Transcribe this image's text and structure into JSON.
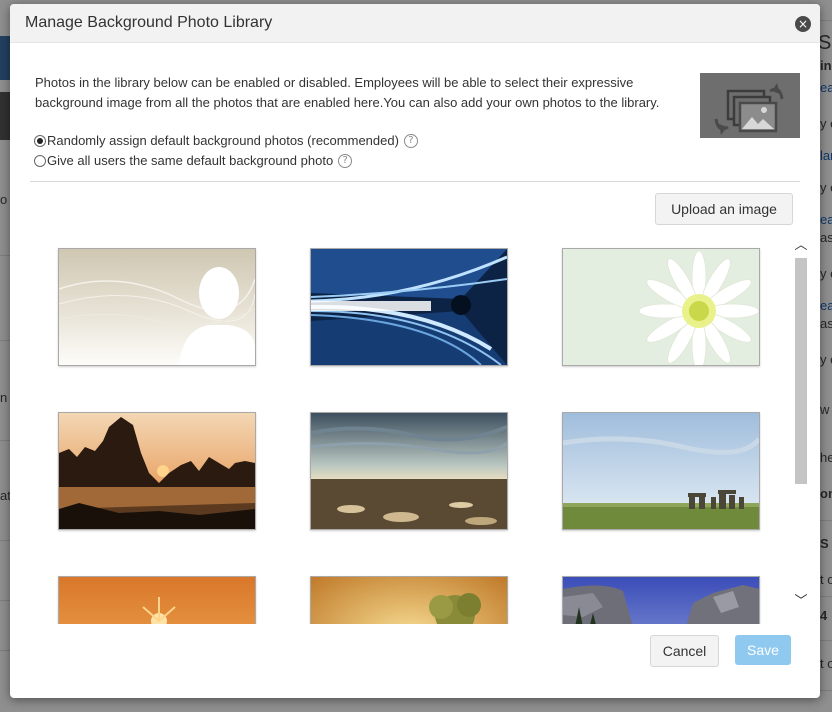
{
  "dialog": {
    "title": "Manage Background Photo Library",
    "close_glyph": "×",
    "description": "Photos in the library below can be enabled or disabled. Employees will be able to select their expressive background image from all the photos that are enabled here.You can also add your own photos to the library.",
    "hero_icon": "photo-library-sync-icon",
    "options": [
      {
        "label": "Randomly assign default background photos (recommended)",
        "selected": true
      },
      {
        "label": "Give all users the same default background photo",
        "selected": false
      }
    ],
    "help_glyph": "?",
    "upload_label": "Upload an image",
    "photos": [
      {
        "icon": "silhouette-photo"
      },
      {
        "icon": "light-tunnel-photo"
      },
      {
        "icon": "white-flower-photo"
      },
      {
        "icon": "karst-sunset-photo"
      },
      {
        "icon": "ocean-horizon-photo"
      },
      {
        "icon": "stonehenge-photo"
      },
      {
        "icon": "orange-sunset-photo"
      },
      {
        "icon": "parchment-tree-photo"
      },
      {
        "icon": "mountain-cliffs-photo"
      }
    ],
    "scroll_up_glyph": "︿",
    "scroll_down_glyph": "﹀",
    "cancel_label": "Cancel",
    "save_label": "Save"
  },
  "background": {
    "fragments": [
      "Se",
      "in",
      "ea",
      "y e",
      "lar",
      "y e",
      "ea",
      "as",
      "y e",
      "ea",
      "as",
      "y e",
      "w p",
      "he",
      "on",
      "S",
      "t o",
      "4",
      "t o",
      "o",
      "n",
      "ati"
    ]
  },
  "colors": {
    "save_disabled": "#8fc9ef",
    "header_bg": "#f2f2f2",
    "overlay": "#000000"
  }
}
